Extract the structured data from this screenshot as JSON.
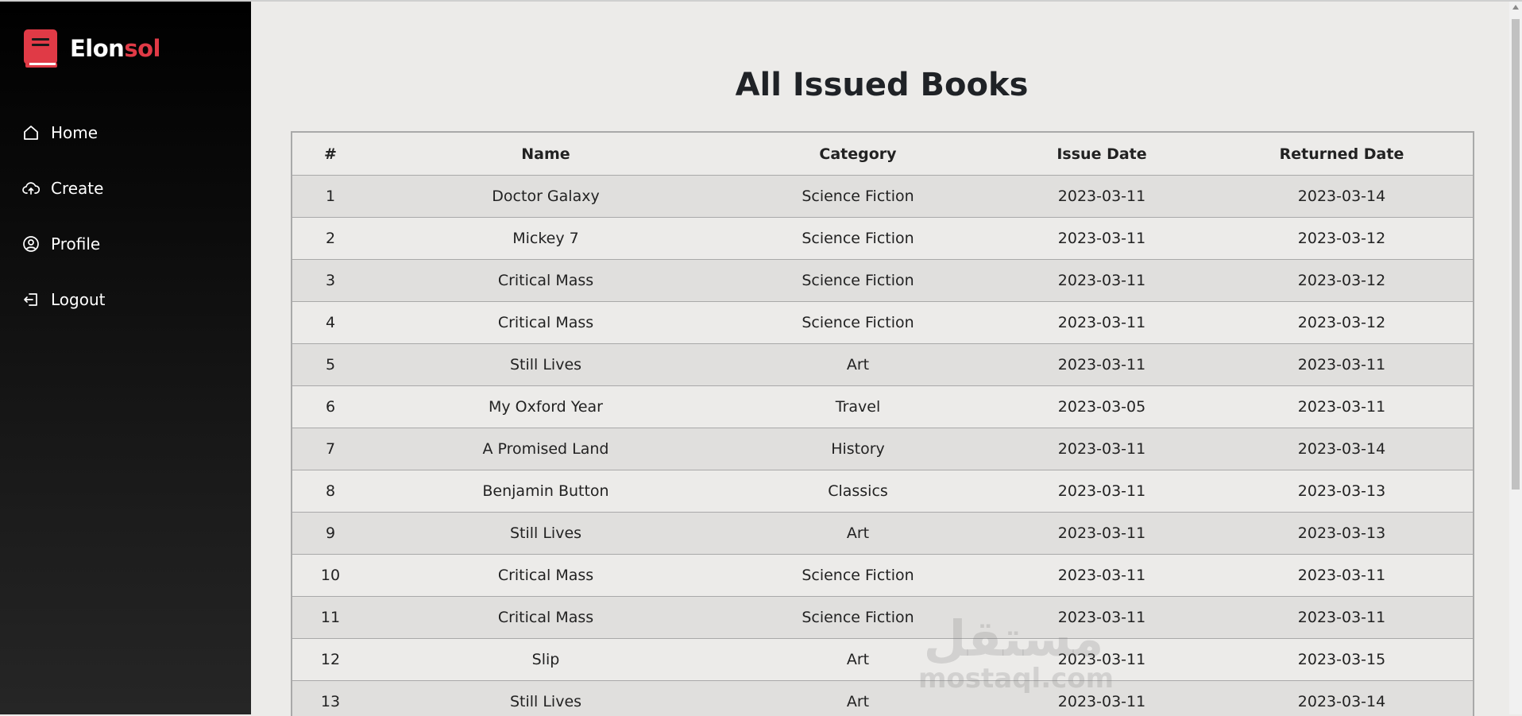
{
  "brand": {
    "name_part1": "Elon",
    "name_part2": "sol",
    "accent": "#e03a46",
    "icon": "book-icon"
  },
  "sidebar": {
    "items": [
      {
        "label": "Home",
        "icon": "home-icon"
      },
      {
        "label": "Create",
        "icon": "cloud-upload-icon"
      },
      {
        "label": "Profile",
        "icon": "user-circle-icon"
      },
      {
        "label": "Logout",
        "icon": "logout-icon"
      }
    ]
  },
  "main": {
    "title": "All Issued Books",
    "table": {
      "headers": [
        "#",
        "Name",
        "Category",
        "Issue Date",
        "Returned Date"
      ],
      "rows": [
        [
          "1",
          "Doctor Galaxy",
          "Science Fiction",
          "2023-03-11",
          "2023-03-14"
        ],
        [
          "2",
          "Mickey 7",
          "Science Fiction",
          "2023-03-11",
          "2023-03-12"
        ],
        [
          "3",
          "Critical Mass",
          "Science Fiction",
          "2023-03-11",
          "2023-03-12"
        ],
        [
          "4",
          "Critical Mass",
          "Science Fiction",
          "2023-03-11",
          "2023-03-12"
        ],
        [
          "5",
          "Still Lives",
          "Art",
          "2023-03-11",
          "2023-03-11"
        ],
        [
          "6",
          "My Oxford Year",
          "Travel",
          "2023-03-05",
          "2023-03-11"
        ],
        [
          "7",
          "A Promised Land",
          "History",
          "2023-03-11",
          "2023-03-14"
        ],
        [
          "8",
          "Benjamin Button",
          "Classics",
          "2023-03-11",
          "2023-03-13"
        ],
        [
          "9",
          "Still Lives",
          "Art",
          "2023-03-11",
          "2023-03-13"
        ],
        [
          "10",
          "Critical Mass",
          "Science Fiction",
          "2023-03-11",
          "2023-03-11"
        ],
        [
          "11",
          "Critical Mass",
          "Science Fiction",
          "2023-03-11",
          "2023-03-11"
        ],
        [
          "12",
          "Slip",
          "Art",
          "2023-03-11",
          "2023-03-15"
        ],
        [
          "13",
          "Still Lives",
          "Art",
          "2023-03-11",
          "2023-03-14"
        ]
      ]
    }
  },
  "watermark": {
    "arabic": "مستقل",
    "latin": "mostaql.com"
  }
}
